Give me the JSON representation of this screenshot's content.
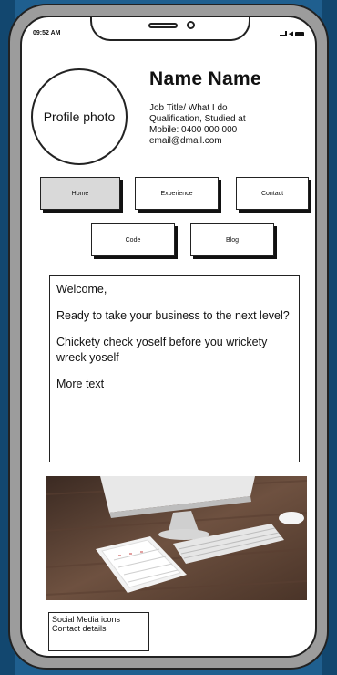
{
  "status_bar": {
    "time": "09:52 AM"
  },
  "profile": {
    "photo_label": "Profile photo",
    "name": "Name Name",
    "details": [
      "Job Title/ What I do",
      "Qualification, Studied at",
      "Mobile: 0400 000 000",
      "email@dmail.com"
    ]
  },
  "nav": {
    "home": "Home",
    "experience": "Experience",
    "contact": "Contact",
    "code": "Code",
    "blog": "Blog",
    "active": "home"
  },
  "content": {
    "paragraphs": [
      "Welcome,",
      "Ready to take your business to the next level?",
      "Chickety check yoself before you wrickety wreck yoself",
      "More text"
    ]
  },
  "image": {
    "description_icon": "desk-photo"
  },
  "footer": {
    "lines": [
      "Social Media icons",
      "Contact details"
    ]
  },
  "colors": {
    "background": "#1f5f8f",
    "active_button": "#d9d9d9"
  }
}
